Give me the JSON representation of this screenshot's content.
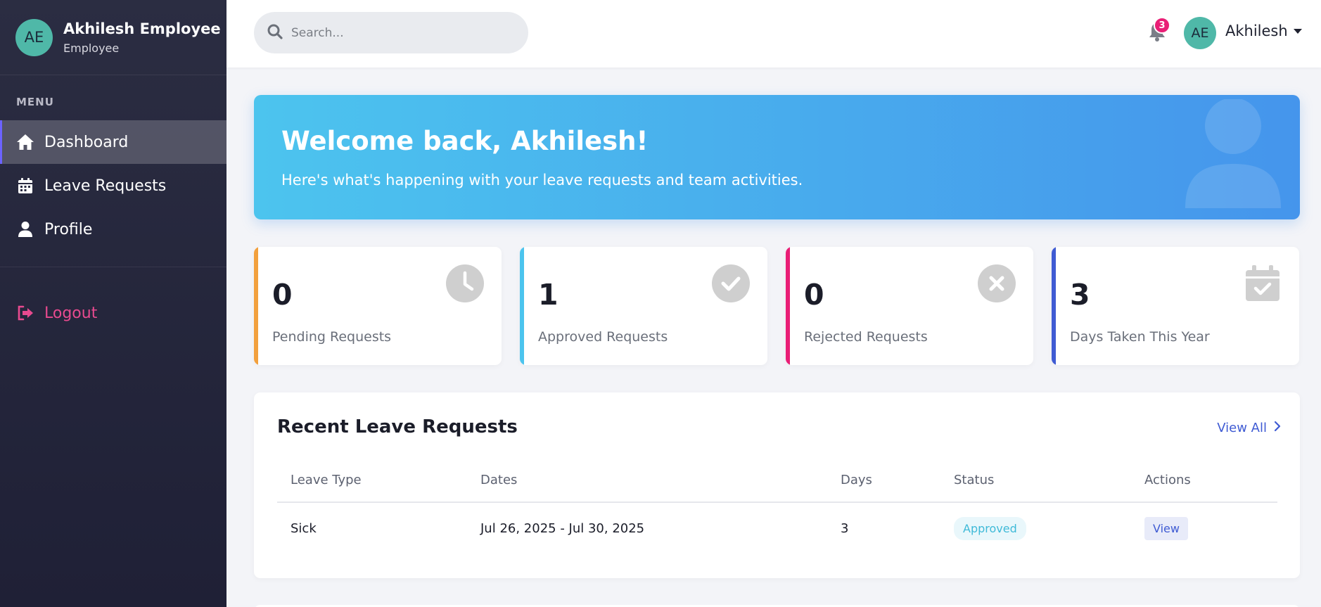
{
  "sidebar": {
    "avatar_initials": "AE",
    "user_name": "Akhilesh Employee",
    "user_role": "Employee",
    "menu_title": "MENU",
    "items": [
      {
        "label": "Dashboard",
        "icon": "home-icon",
        "active": true
      },
      {
        "label": "Leave Requests",
        "icon": "calendar-icon",
        "active": false
      },
      {
        "label": "Profile",
        "icon": "user-icon",
        "active": false
      }
    ],
    "logout_label": "Logout"
  },
  "topbar": {
    "search_placeholder": "Search...",
    "notification_count": "3",
    "avatar_initials": "AE",
    "user_name": "Akhilesh"
  },
  "banner": {
    "title": "Welcome back, Akhilesh!",
    "subtitle": "Here's what's happening with your leave requests and team activities."
  },
  "stats": [
    {
      "value": "0",
      "label": "Pending Requests",
      "color": "#f2a03d",
      "icon": "clock-icon"
    },
    {
      "value": "1",
      "label": "Approved Requests",
      "color": "#4cc4ee",
      "icon": "check-circle-icon"
    },
    {
      "value": "0",
      "label": "Rejected Requests",
      "color": "#e91e76",
      "icon": "x-circle-icon"
    },
    {
      "value": "3",
      "label": "Days Taken This Year",
      "color": "#3f5bd3",
      "icon": "calendar-check-icon"
    }
  ],
  "recent": {
    "title": "Recent Leave Requests",
    "view_all_label": "View All",
    "columns": [
      "Leave Type",
      "Dates",
      "Days",
      "Status",
      "Actions"
    ],
    "rows": [
      {
        "type": "Sick",
        "dates": "Jul 26, 2025 - Jul 30, 2025",
        "days": "3",
        "status": "Approved",
        "action": "View"
      }
    ]
  }
}
